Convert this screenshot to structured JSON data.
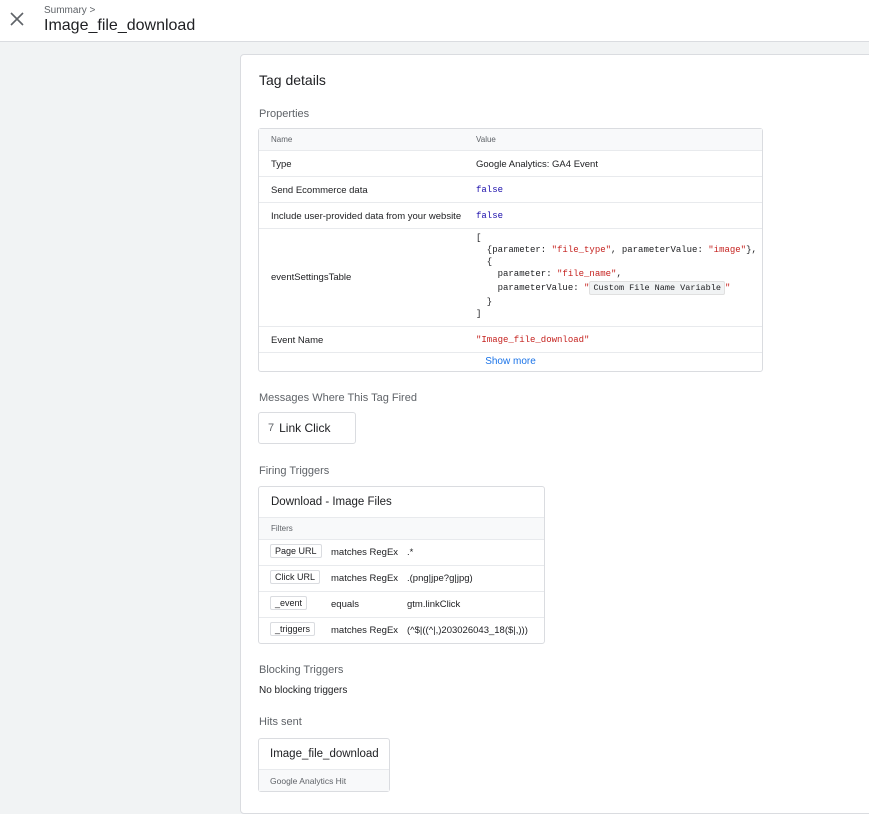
{
  "header": {
    "breadcrumb": "Summary >",
    "title": "Image_file_download",
    "close_icon": "close-icon"
  },
  "panel": {
    "title": "Tag details",
    "properties": {
      "section_label": "Properties",
      "col_name": "Name",
      "col_value": "Value",
      "rows": [
        {
          "name": "Type",
          "value": "Google Analytics: GA4 Event"
        },
        {
          "name": "Send Ecommerce data",
          "value": "false"
        },
        {
          "name": "Include user-provided data from your website",
          "value": "false"
        },
        {
          "name": "eventSettingsTable",
          "value": ""
        },
        {
          "name": "Event Name",
          "value": "\"Image_file_download\""
        }
      ],
      "code": {
        "open_bracket": "[",
        "l1_a": "  {parameter: ",
        "l1_b": "\"file_type\"",
        "l1_c": ", parameterValue: ",
        "l1_d": "\"image\"",
        "l1_e": "},",
        "l2": "  {",
        "l3_a": "    parameter: ",
        "l3_b": "\"file_name\"",
        "l3_c": ",",
        "l4_a": "    parameterValue: ",
        "l4_b": "\"",
        "l4_var": "Custom File Name Variable",
        "l4_c": "\"",
        "l5": "  }",
        "close_bracket": "]"
      },
      "show_more": "Show more"
    },
    "messages": {
      "section_label": "Messages Where This Tag Fired",
      "chip_number": "7",
      "chip_label": "Link Click"
    },
    "firing": {
      "section_label": "Firing Triggers",
      "trigger_name": "Download - Image Files",
      "filters_label": "Filters",
      "filters": [
        {
          "variable": "Page URL",
          "operator": "matches RegEx",
          "value": ".*"
        },
        {
          "variable": "Click URL",
          "operator": "matches RegEx",
          "value": ".(png|jpe?g|jpg)"
        },
        {
          "variable": "_event",
          "operator": "equals",
          "value": "gtm.linkClick"
        },
        {
          "variable": "_triggers",
          "operator": "matches RegEx",
          "value": "(^$|((^|,)203026043_18($|,)))"
        }
      ]
    },
    "blocking": {
      "section_label": "Blocking Triggers",
      "text": "No blocking triggers"
    },
    "hits": {
      "section_label": "Hits sent",
      "hit_name": "Image_file_download",
      "hit_type": "Google Analytics Hit"
    }
  }
}
